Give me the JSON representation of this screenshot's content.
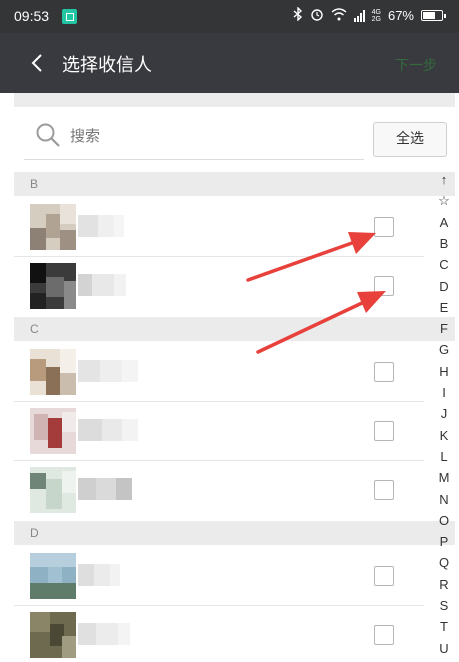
{
  "status_bar": {
    "time": "09:53",
    "network_top": "4G",
    "network_bottom": "2G",
    "battery": "67%",
    "battery_level": 0.67
  },
  "title_bar": {
    "title": "选择收信人",
    "next_label": "下一步"
  },
  "search": {
    "placeholder": "搜索",
    "select_all_label": "全选"
  },
  "sections": [
    {
      "letter": "B",
      "contacts": [
        {
          "checked": false
        },
        {
          "checked": false
        }
      ]
    },
    {
      "letter": "C",
      "contacts": [
        {
          "checked": false
        },
        {
          "checked": false
        },
        {
          "checked": false
        }
      ]
    },
    {
      "letter": "D",
      "contacts": [
        {
          "checked": false
        },
        {
          "checked": false
        }
      ]
    }
  ],
  "index_letters": [
    "↑",
    "☆",
    "A",
    "B",
    "C",
    "D",
    "E",
    "F",
    "G",
    "H",
    "I",
    "J",
    "K",
    "L",
    "M",
    "N",
    "O",
    "P",
    "Q",
    "R",
    "S",
    "T",
    "U"
  ],
  "colors": {
    "title_bar": "#393a3f",
    "status_bar": "#333537",
    "next_label": "#336b3a",
    "annotation_arrow": "#e8403a"
  }
}
